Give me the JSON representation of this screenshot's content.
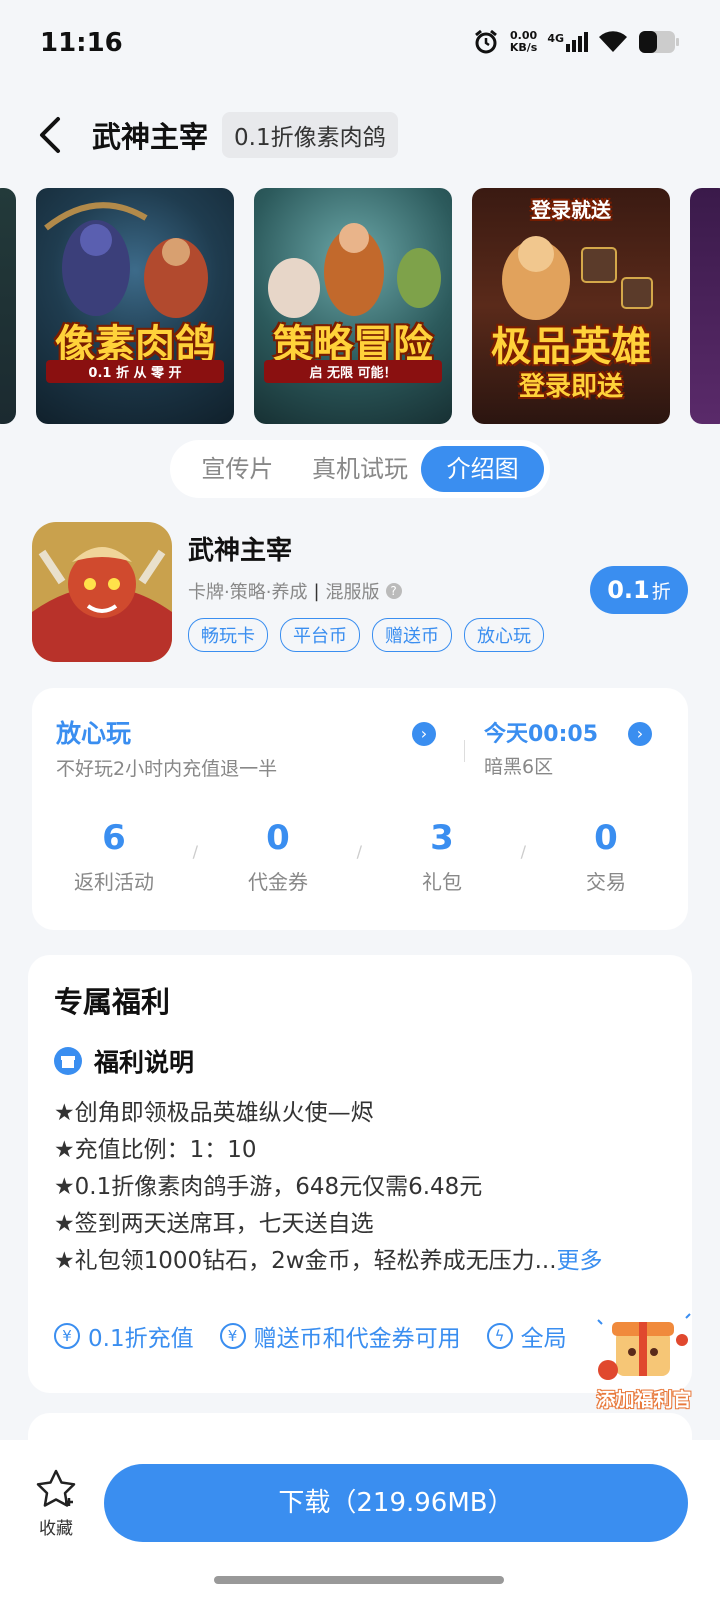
{
  "status_bar": {
    "time": "11:16",
    "net_speed_value": "0.00",
    "net_speed_unit": "KB/s",
    "network": "4G",
    "icons": [
      "alarm-icon",
      "signal-icon",
      "wifi-icon",
      "battery-icon"
    ]
  },
  "header": {
    "title": "武神主宰",
    "tag": "0.1折像素肉鸽"
  },
  "carousel": {
    "slides": [
      {
        "caption": "像素肉鸽",
        "sub": "0.1 折 从 零 开"
      },
      {
        "caption": "策略冒险",
        "sub": "启 无限 可能！"
      },
      {
        "caption": "极品英雄",
        "top": "登录就送",
        "sub": "登录即送"
      }
    ]
  },
  "media_tabs": [
    {
      "label": "宣传片",
      "active": false
    },
    {
      "label": "真机试玩",
      "active": false
    },
    {
      "label": "介绍图",
      "active": true
    }
  ],
  "app": {
    "name": "武神主宰",
    "categories": "卡牌·策略·养成",
    "separator": "|",
    "server_type": "混服版",
    "tags": [
      "畅玩卡",
      "平台币",
      "赠送币",
      "放心玩"
    ],
    "discount_value": "0.1",
    "discount_unit": "折"
  },
  "assurance": {
    "title": "放心玩",
    "desc": "不好玩2小时内充值退一半",
    "open_time": "今天00:05",
    "server_name": "暗黑6区"
  },
  "stats": [
    {
      "value": "6",
      "label": "返利活动"
    },
    {
      "value": "0",
      "label": "代金券"
    },
    {
      "value": "3",
      "label": "礼包"
    },
    {
      "value": "0",
      "label": "交易"
    }
  ],
  "welfare": {
    "title": "专属福利",
    "subtitle": "福利说明",
    "lines": [
      "★创角即领极品英雄纵火使—烬",
      "★充值比例：1：10",
      "★0.1折像素肉鸽手游，648元仅需6.48元",
      "★签到两天送席耳，七天送自选",
      "★礼包领1000钻石，2w金币，轻松养成无压力..."
    ],
    "more_label": "更多",
    "perks": [
      "0.1折充值",
      "赠送币和代金券可用",
      "全局"
    ]
  },
  "floating": {
    "label": "添加福利官"
  },
  "bottom": {
    "fav_label": "收藏",
    "download_label": "下载（219.96MB）"
  },
  "colors": {
    "accent": "#3a8ef0",
    "background": "#f4f6f9"
  }
}
